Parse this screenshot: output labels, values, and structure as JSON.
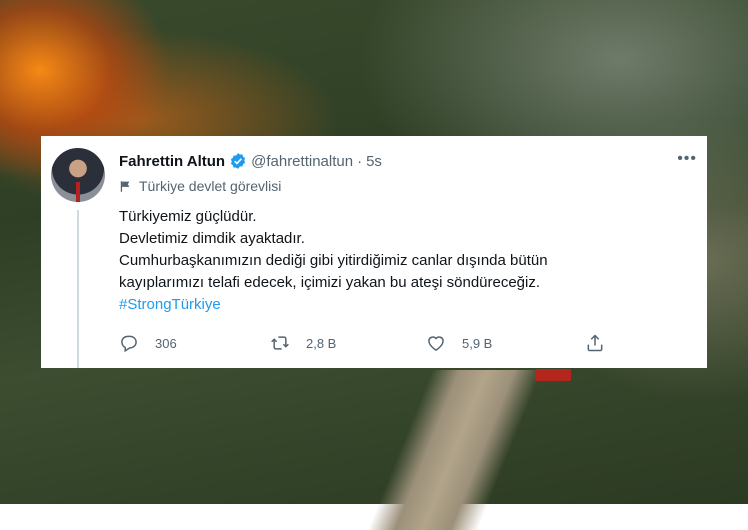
{
  "tweet": {
    "name": "Fahrettin Altun",
    "handle": "@fahrettinaltun",
    "separator": "·",
    "time": "5s",
    "label": "Türkiye devlet görevlisi",
    "more": "•••",
    "lines": [
      "Türkiyemiz güçlüdür.",
      "Devletimiz dimdik ayaktadır.",
      "Cumhurbaşkanımızın dediği gibi yitirdiğimiz canlar dışında bütün",
      "kayıplarımızı telafi edecek, içimizi yakan bu ateşi söndüreceğiz."
    ],
    "hashtag": "#StrongTürkiye",
    "actions": {
      "reply_count": "306",
      "retweet_count": "2,8 B",
      "like_count": "5,9 B"
    }
  },
  "colors": {
    "verified": "#1d9bf0",
    "link": "#1d9bf0",
    "muted": "#536471"
  }
}
